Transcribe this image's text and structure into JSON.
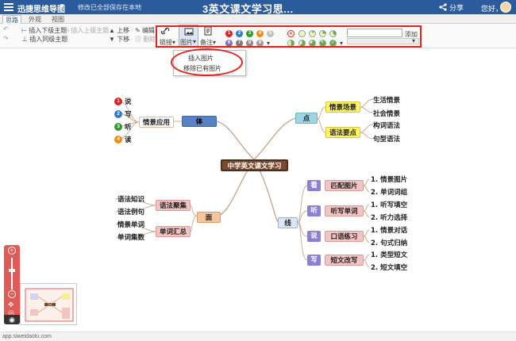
{
  "topbar": {
    "app_name": "迅捷思维导图",
    "saved_text": "修改已全部保存在本地",
    "doc_title": "3英文课文学习思...",
    "share": "分享",
    "greeting": "您好，"
  },
  "tabs": [
    "思路",
    "外观",
    "视图"
  ],
  "toolbar": {
    "insert_child": "插入下级主题",
    "insert_parent": "插入上级主题",
    "insert_sibling": "插入同级主题",
    "move_up": "上移",
    "move_down": "下移",
    "edit": "编辑",
    "delete": "删除",
    "link": "链接",
    "image": "图片",
    "note": "备注",
    "add_tag": "添加"
  },
  "image_menu": {
    "insert": "插入图片",
    "remove": "移除已有图片"
  },
  "colors": {
    "accent": "#2b5b9c",
    "highlight": "#e2231a"
  },
  "mindmap": {
    "central": "中学英文课文学习",
    "ti": {
      "label": "体",
      "child": "情景应用",
      "leaves": [
        {
          "badge": "1",
          "text": "说"
        },
        {
          "badge": "2",
          "text": "写"
        },
        {
          "badge": "3",
          "text": "听"
        },
        {
          "badge": "4",
          "text": "读"
        }
      ]
    },
    "dian": {
      "label": "点",
      "branches": [
        {
          "label": "情景场景",
          "leaves": [
            "生活情景",
            "社会情景"
          ]
        },
        {
          "label": "语法要点",
          "leaves": [
            "构词语法",
            "句型语法"
          ]
        }
      ]
    },
    "mian": {
      "label": "面",
      "branches": [
        {
          "label": "语法聚集",
          "leaves": [
            "语法知识",
            "语法例句"
          ]
        },
        {
          "label": "单词汇总",
          "leaves": [
            "情景单词",
            "单词集数"
          ]
        }
      ]
    },
    "xian": {
      "label": "线",
      "branches": [
        {
          "tag": "看",
          "label": "匹配图片",
          "leaves": [
            "1. 情景图片",
            "2. 单词词组"
          ]
        },
        {
          "tag": "听",
          "label": "听写单词",
          "leaves": [
            "1. 听写填空",
            "2. 听力选择"
          ]
        },
        {
          "tag": "说",
          "label": "口语练习",
          "leaves": [
            "1. 情景对话",
            "2. 句式归纳"
          ]
        },
        {
          "tag": "写",
          "label": "短文改写",
          "leaves": [
            "1. 类型短文",
            "2. 短文填空"
          ]
        }
      ]
    }
  },
  "status_url": "app.siweidaotu.com"
}
